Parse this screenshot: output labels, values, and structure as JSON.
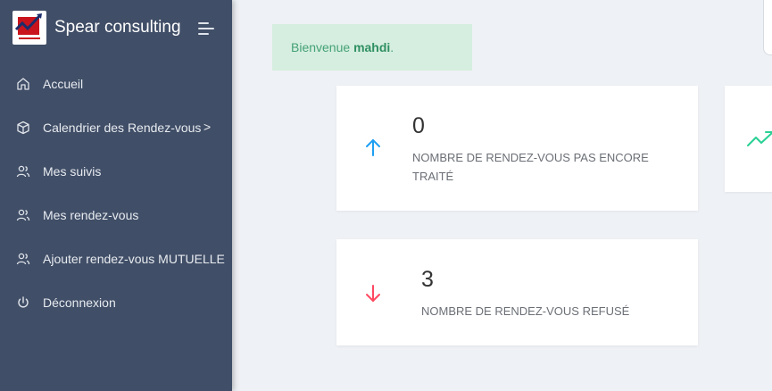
{
  "brand": {
    "name": "Spear consulting"
  },
  "sidebar": {
    "items": [
      {
        "label": "Accueil",
        "icon": "home-icon"
      },
      {
        "label": "Calendrier des Rendez-vous",
        "icon": "box-icon",
        "chevron": ">"
      },
      {
        "label": "Mes suivis",
        "icon": "users-icon"
      },
      {
        "label": "Mes rendez-vous",
        "icon": "users-icon"
      },
      {
        "label": "Ajouter rendez-vous MUTUELLE",
        "icon": "users-icon"
      },
      {
        "label": "Déconnexion",
        "icon": "power-icon"
      }
    ]
  },
  "welcome": {
    "prefix": "Bienvenue ",
    "username": "mahdi",
    "suffix": "."
  },
  "cards": [
    {
      "value": "0",
      "label": "NOMBRE DE RENDEZ-VOUS PAS ENCORE TRAITÉ",
      "icon": "arrow-up-icon",
      "color": "#1e9ff2"
    },
    {
      "value": "3",
      "label": "NOMBRE DE RENDEZ-VOUS REFUSÉ",
      "icon": "arrow-down-icon",
      "color": "#ff4961"
    },
    {
      "icon": "trending-up-icon",
      "color": "#28d094"
    }
  ],
  "colors": {
    "sidebar": "#404e67",
    "background": "#eef1f5",
    "welcome_bg": "#d5eedf",
    "welcome_text": "#45a177"
  }
}
